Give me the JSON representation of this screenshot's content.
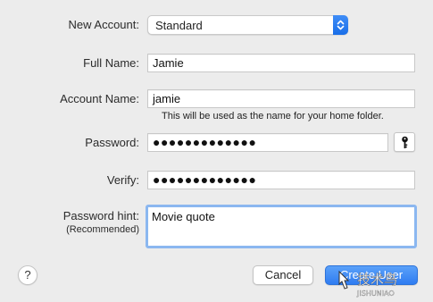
{
  "form": {
    "new_account_label": "New Account:",
    "new_account_value": "Standard",
    "full_name_label": "Full Name:",
    "full_name_value": "Jamie",
    "account_name_label": "Account Name:",
    "account_name_value": "jamie",
    "account_name_hint": "This will be used as the name for your home folder.",
    "password_label": "Password:",
    "password_value": "●●●●●●●●●●●●●",
    "verify_label": "Verify:",
    "verify_value": "●●●●●●●●●●●●●",
    "password_hint_label": "Password hint:",
    "password_hint_sublabel": "(Recommended)",
    "password_hint_value": "Movie quote"
  },
  "buttons": {
    "help_label": "?",
    "cancel_label": "Cancel",
    "create_label": "Create User"
  },
  "watermark": {
    "text": "技术鸟",
    "subtext": "JISHUNIAO"
  },
  "colors": {
    "accent": "#2f7cf1",
    "focus_ring": "#8bb7f0",
    "background": "#ececec"
  },
  "icons": {
    "popup": "up-down-chevrons-icon",
    "password_assistant": "key-icon",
    "help": "question-mark-icon"
  }
}
